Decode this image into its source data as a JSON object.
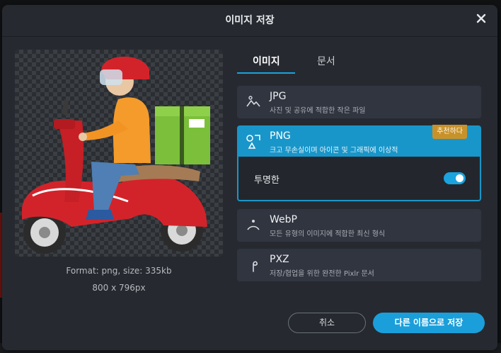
{
  "dialog": {
    "title": "이미지 저장",
    "close_icon": "close-icon"
  },
  "preview": {
    "format_line": "Format: png, size: 335kb",
    "dimensions_line": "800 x 796px",
    "image": "scooter-delivery-man-illustration"
  },
  "tabs": [
    {
      "label": "이미지",
      "active": true
    },
    {
      "label": "문서",
      "active": false
    }
  ],
  "formats": [
    {
      "name": "JPG",
      "desc": "사진 및 공유에 적합한 작은 파일",
      "icon": "landscape-icon",
      "selected": false
    },
    {
      "name": "PNG",
      "desc": "크고 무손실이며 아이콘 및 그래픽에 이상적",
      "icon": "shapes-icon",
      "selected": true,
      "badge": "추천하다"
    },
    {
      "name": "WebP",
      "desc": "모든 유형의 이미지에 적합한 최신 형식",
      "icon": "webp-icon",
      "selected": false
    },
    {
      "name": "PXZ",
      "desc": "저장/협업을 위한 완전한 Pixlr 문서",
      "icon": "pxz-icon",
      "selected": false
    }
  ],
  "png_options": {
    "transparent_label": "투명한",
    "transparent_on": true
  },
  "footer": {
    "cancel_label": "취소",
    "save_as_label": "다른 이름으로 저장"
  },
  "colors": {
    "accent": "#1a9fdb",
    "badge": "#c8922a",
    "panel": "#262a30",
    "option": "#313540"
  }
}
